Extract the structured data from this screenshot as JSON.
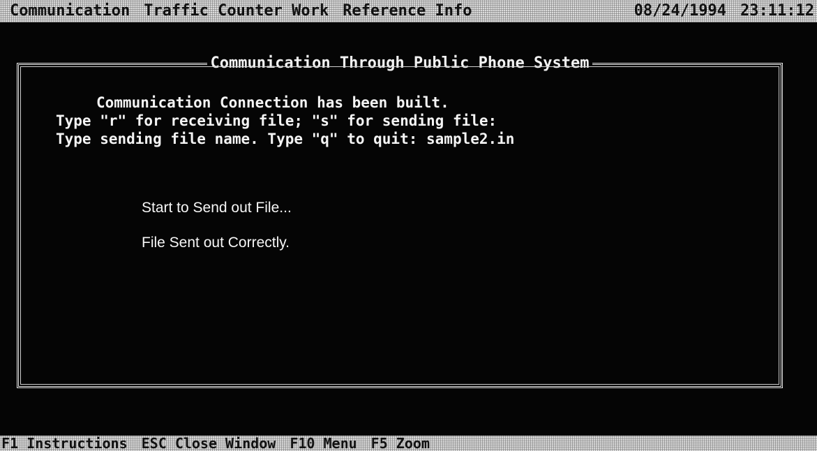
{
  "menu_bar": {
    "items": [
      "Communication",
      "Traffic Counter Work",
      "Reference Info"
    ],
    "date": "08/24/1994",
    "time": "23:11:12"
  },
  "window": {
    "title": "Communication Through Public Phone System",
    "lines": [
      "Communication Connection has been built.",
      "Type \"r\" for receiving file; \"s\" for sending file:",
      "Type sending file name. Type \"q\" to quit: sample2.in"
    ],
    "status_messages": [
      "Start to Send out File...",
      "File Sent out Correctly."
    ]
  },
  "status_bar": {
    "items": [
      {
        "key": "F1",
        "label": "Instructions"
      },
      {
        "key": "ESC",
        "label": "Close Window"
      },
      {
        "key": "F10",
        "label": "Menu"
      },
      {
        "key": "F5",
        "label": "Zoom"
      }
    ]
  },
  "colors": {
    "background": "#050505",
    "bar": "#bdbdbd",
    "text": "#f4f4f4"
  }
}
